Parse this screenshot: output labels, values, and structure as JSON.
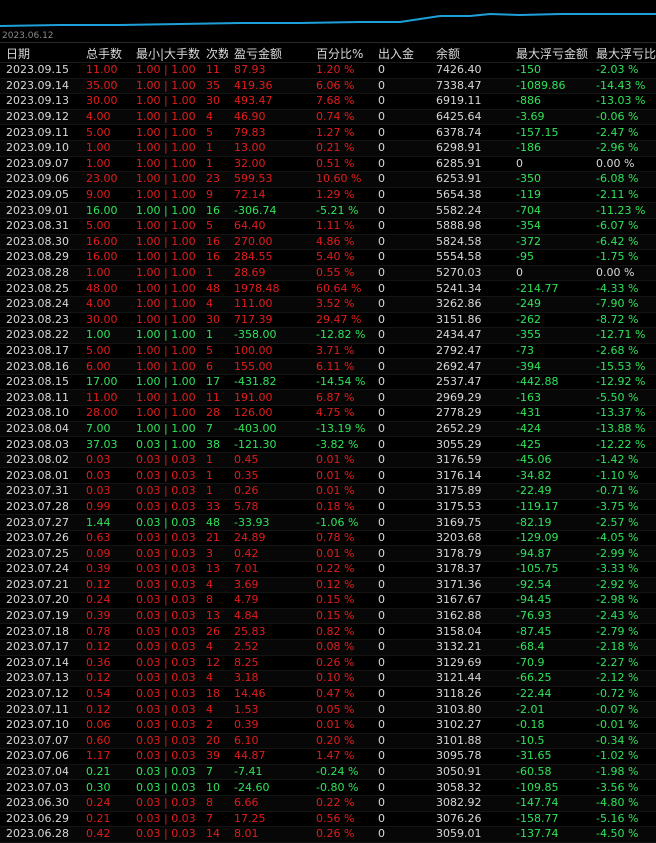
{
  "chart": {
    "date_label": "2023.06.12",
    "line_color": "#1f9fd8"
  },
  "colors": {
    "profit": "#e21c1c",
    "loss": "#2fe35a",
    "text": "#d8d8d8"
  },
  "table": {
    "headers": [
      "日期",
      "总手数",
      "最小|大手数",
      "次数",
      "盈亏金额",
      "百分比%",
      "出入金",
      "余额",
      "最大浮亏金额",
      "最大浮亏比%"
    ],
    "rows": [
      [
        "2023.09.15",
        "11.00",
        "1.00 | 1.00",
        "11",
        "87.93",
        "1.20 %",
        "0",
        "7426.40",
        "-150",
        "-2.03 %"
      ],
      [
        "2023.09.14",
        "35.00",
        "1.00 | 1.00",
        "35",
        "419.36",
        "6.06 %",
        "0",
        "7338.47",
        "-1089.86",
        "-14.43 %"
      ],
      [
        "2023.09.13",
        "30.00",
        "1.00 | 1.00",
        "30",
        "493.47",
        "7.68 %",
        "0",
        "6919.11",
        "-886",
        "-13.03 %"
      ],
      [
        "2023.09.12",
        "4.00",
        "1.00 | 1.00",
        "4",
        "46.90",
        "0.74 %",
        "0",
        "6425.64",
        "-3.69",
        "-0.06 %"
      ],
      [
        "2023.09.11",
        "5.00",
        "1.00 | 1.00",
        "5",
        "79.83",
        "1.27 %",
        "0",
        "6378.74",
        "-157.15",
        "-2.47 %"
      ],
      [
        "2023.09.10",
        "1.00",
        "1.00 | 1.00",
        "1",
        "13.00",
        "0.21 %",
        "0",
        "6298.91",
        "-186",
        "-2.96 %"
      ],
      [
        "2023.09.07",
        "1.00",
        "1.00 | 1.00",
        "1",
        "32.00",
        "0.51 %",
        "0",
        "6285.91",
        "0",
        "0.00 %"
      ],
      [
        "2023.09.06",
        "23.00",
        "1.00 | 1.00",
        "23",
        "599.53",
        "10.60 %",
        "0",
        "6253.91",
        "-350",
        "-6.08 %"
      ],
      [
        "2023.09.05",
        "9.00",
        "1.00 | 1.00",
        "9",
        "72.14",
        "1.29 %",
        "0",
        "5654.38",
        "-119",
        "-2.11 %"
      ],
      [
        "2023.09.01",
        "16.00",
        "1.00 | 1.00",
        "16",
        "-306.74",
        "-5.21 %",
        "0",
        "5582.24",
        "-704",
        "-11.23 %"
      ],
      [
        "2023.08.31",
        "5.00",
        "1.00 | 1.00",
        "5",
        "64.40",
        "1.11 %",
        "0",
        "5888.98",
        "-354",
        "-6.07 %"
      ],
      [
        "2023.08.30",
        "16.00",
        "1.00 | 1.00",
        "16",
        "270.00",
        "4.86 %",
        "0",
        "5824.58",
        "-372",
        "-6.42 %"
      ],
      [
        "2023.08.29",
        "16.00",
        "1.00 | 1.00",
        "16",
        "284.55",
        "5.40 %",
        "0",
        "5554.58",
        "-95",
        "-1.75 %"
      ],
      [
        "2023.08.28",
        "1.00",
        "1.00 | 1.00",
        "1",
        "28.69",
        "0.55 %",
        "0",
        "5270.03",
        "0",
        "0.00 %"
      ],
      [
        "2023.08.25",
        "48.00",
        "1.00 | 1.00",
        "48",
        "1978.48",
        "60.64 %",
        "0",
        "5241.34",
        "-214.77",
        "-4.33 %"
      ],
      [
        "2023.08.24",
        "4.00",
        "1.00 | 1.00",
        "4",
        "111.00",
        "3.52 %",
        "0",
        "3262.86",
        "-249",
        "-7.90 %"
      ],
      [
        "2023.08.23",
        "30.00",
        "1.00 | 1.00",
        "30",
        "717.39",
        "29.47 %",
        "0",
        "3151.86",
        "-262",
        "-8.72 %"
      ],
      [
        "2023.08.22",
        "1.00",
        "1.00 | 1.00",
        "1",
        "-358.00",
        "-12.82 %",
        "0",
        "2434.47",
        "-355",
        "-12.71 %"
      ],
      [
        "2023.08.17",
        "5.00",
        "1.00 | 1.00",
        "5",
        "100.00",
        "3.71 %",
        "0",
        "2792.47",
        "-73",
        "-2.68 %"
      ],
      [
        "2023.08.16",
        "6.00",
        "1.00 | 1.00",
        "6",
        "155.00",
        "6.11 %",
        "0",
        "2692.47",
        "-394",
        "-15.53 %"
      ],
      [
        "2023.08.15",
        "17.00",
        "1.00 | 1.00",
        "17",
        "-431.82",
        "-14.54 %",
        "0",
        "2537.47",
        "-442.88",
        "-12.92 %"
      ],
      [
        "2023.08.11",
        "11.00",
        "1.00 | 1.00",
        "11",
        "191.00",
        "6.87 %",
        "0",
        "2969.29",
        "-163",
        "-5.50 %"
      ],
      [
        "2023.08.10",
        "28.00",
        "1.00 | 1.00",
        "28",
        "126.00",
        "4.75 %",
        "0",
        "2778.29",
        "-431",
        "-13.37 %"
      ],
      [
        "2023.08.04",
        "7.00",
        "1.00 | 1.00",
        "7",
        "-403.00",
        "-13.19 %",
        "0",
        "2652.29",
        "-424",
        "-13.88 %"
      ],
      [
        "2023.08.03",
        "37.03",
        "0.03 | 1.00",
        "38",
        "-121.30",
        "-3.82 %",
        "0",
        "3055.29",
        "-425",
        "-12.22 %"
      ],
      [
        "2023.08.02",
        "0.03",
        "0.03 | 0.03",
        "1",
        "0.45",
        "0.01 %",
        "0",
        "3176.59",
        "-45.06",
        "-1.42 %"
      ],
      [
        "2023.08.01",
        "0.03",
        "0.03 | 0.03",
        "1",
        "0.35",
        "0.01 %",
        "0",
        "3176.14",
        "-34.82",
        "-1.10 %"
      ],
      [
        "2023.07.31",
        "0.03",
        "0.03 | 0.03",
        "1",
        "0.26",
        "0.01 %",
        "0",
        "3175.89",
        "-22.49",
        "-0.71 %"
      ],
      [
        "2023.07.28",
        "0.99",
        "0.03 | 0.03",
        "33",
        "5.78",
        "0.18 %",
        "0",
        "3175.53",
        "-119.17",
        "-3.75 %"
      ],
      [
        "2023.07.27",
        "1.44",
        "0.03 | 0.03",
        "48",
        "-33.93",
        "-1.06 %",
        "0",
        "3169.75",
        "-82.19",
        "-2.57 %"
      ],
      [
        "2023.07.26",
        "0.63",
        "0.03 | 0.03",
        "21",
        "24.89",
        "0.78 %",
        "0",
        "3203.68",
        "-129.09",
        "-4.05 %"
      ],
      [
        "2023.07.25",
        "0.09",
        "0.03 | 0.03",
        "3",
        "0.42",
        "0.01 %",
        "0",
        "3178.79",
        "-94.87",
        "-2.99 %"
      ],
      [
        "2023.07.24",
        "0.39",
        "0.03 | 0.03",
        "13",
        "7.01",
        "0.22 %",
        "0",
        "3178.37",
        "-105.75",
        "-3.33 %"
      ],
      [
        "2023.07.21",
        "0.12",
        "0.03 | 0.03",
        "4",
        "3.69",
        "0.12 %",
        "0",
        "3171.36",
        "-92.54",
        "-2.92 %"
      ],
      [
        "2023.07.20",
        "0.24",
        "0.03 | 0.03",
        "8",
        "4.79",
        "0.15 %",
        "0",
        "3167.67",
        "-94.45",
        "-2.98 %"
      ],
      [
        "2023.07.19",
        "0.39",
        "0.03 | 0.03",
        "13",
        "4.84",
        "0.15 %",
        "0",
        "3162.88",
        "-76.93",
        "-2.43 %"
      ],
      [
        "2023.07.18",
        "0.78",
        "0.03 | 0.03",
        "26",
        "25.83",
        "0.82 %",
        "0",
        "3158.04",
        "-87.45",
        "-2.79 %"
      ],
      [
        "2023.07.17",
        "0.12",
        "0.03 | 0.03",
        "4",
        "2.52",
        "0.08 %",
        "0",
        "3132.21",
        "-68.4",
        "-2.18 %"
      ],
      [
        "2023.07.14",
        "0.36",
        "0.03 | 0.03",
        "12",
        "8.25",
        "0.26 %",
        "0",
        "3129.69",
        "-70.9",
        "-2.27 %"
      ],
      [
        "2023.07.13",
        "0.12",
        "0.03 | 0.03",
        "4",
        "3.18",
        "0.10 %",
        "0",
        "3121.44",
        "-66.25",
        "-2.12 %"
      ],
      [
        "2023.07.12",
        "0.54",
        "0.03 | 0.03",
        "18",
        "14.46",
        "0.47 %",
        "0",
        "3118.26",
        "-22.44",
        "-0.72 %"
      ],
      [
        "2023.07.11",
        "0.12",
        "0.03 | 0.03",
        "4",
        "1.53",
        "0.05 %",
        "0",
        "3103.80",
        "-2.01",
        "-0.07 %"
      ],
      [
        "2023.07.10",
        "0.06",
        "0.03 | 0.03",
        "2",
        "0.39",
        "0.01 %",
        "0",
        "3102.27",
        "-0.18",
        "-0.01 %"
      ],
      [
        "2023.07.07",
        "0.60",
        "0.03 | 0.03",
        "20",
        "6.10",
        "0.20 %",
        "0",
        "3101.88",
        "-10.5",
        "-0.34 %"
      ],
      [
        "2023.07.06",
        "1.17",
        "0.03 | 0.03",
        "39",
        "44.87",
        "1.47 %",
        "0",
        "3095.78",
        "-31.65",
        "-1.02 %"
      ],
      [
        "2023.07.04",
        "0.21",
        "0.03 | 0.03",
        "7",
        "-7.41",
        "-0.24 %",
        "0",
        "3050.91",
        "-60.58",
        "-1.98 %"
      ],
      [
        "2023.07.03",
        "0.30",
        "0.03 | 0.03",
        "10",
        "-24.60",
        "-0.80 %",
        "0",
        "3058.32",
        "-109.85",
        "-3.56 %"
      ],
      [
        "2023.06.30",
        "0.24",
        "0.03 | 0.03",
        "8",
        "6.66",
        "0.22 %",
        "0",
        "3082.92",
        "-147.74",
        "-4.80 %"
      ],
      [
        "2023.06.29",
        "0.21",
        "0.03 | 0.03",
        "7",
        "17.25",
        "0.56 %",
        "0",
        "3076.26",
        "-158.77",
        "-5.16 %"
      ],
      [
        "2023.06.28",
        "0.42",
        "0.03 | 0.03",
        "14",
        "8.01",
        "0.26 %",
        "0",
        "3059.01",
        "-137.74",
        "-4.50 %"
      ]
    ]
  }
}
